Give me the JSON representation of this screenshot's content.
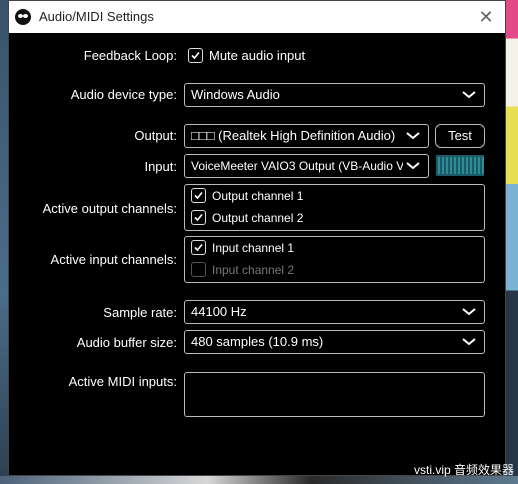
{
  "window": {
    "title": "Audio/MIDI Settings",
    "close_glyph": "✕"
  },
  "feedback": {
    "label": "Feedback Loop:",
    "checkbox_label": "Mute audio input",
    "checked": true
  },
  "device_type": {
    "label": "Audio device type:",
    "value": "Windows Audio"
  },
  "output": {
    "label": "Output:",
    "value": "□□□ (Realtek High Definition Audio)",
    "test_label": "Test"
  },
  "input": {
    "label": "Input:",
    "value": "VoiceMeeter VAIO3 Output (VB-Audio Vo..."
  },
  "active_output": {
    "label": "Active output channels:",
    "channels": [
      {
        "label": "Output channel 1",
        "checked": true
      },
      {
        "label": "Output channel 2",
        "checked": true
      }
    ]
  },
  "active_input": {
    "label": "Active input channels:",
    "channels": [
      {
        "label": "Input channel 1",
        "checked": true
      },
      {
        "label": "Input channel 2",
        "checked": false
      }
    ]
  },
  "sample_rate": {
    "label": "Sample rate:",
    "value": "44100 Hz"
  },
  "buffer_size": {
    "label": "Audio buffer size:",
    "value": "480 samples (10.9 ms)"
  },
  "midi": {
    "label": "Active MIDI inputs:"
  },
  "watermark": "vsti.vip 音频效果器",
  "colors": {
    "window_bg": "#000000",
    "titlebar_bg": "#ffffff",
    "meter": "#1b5b66"
  }
}
